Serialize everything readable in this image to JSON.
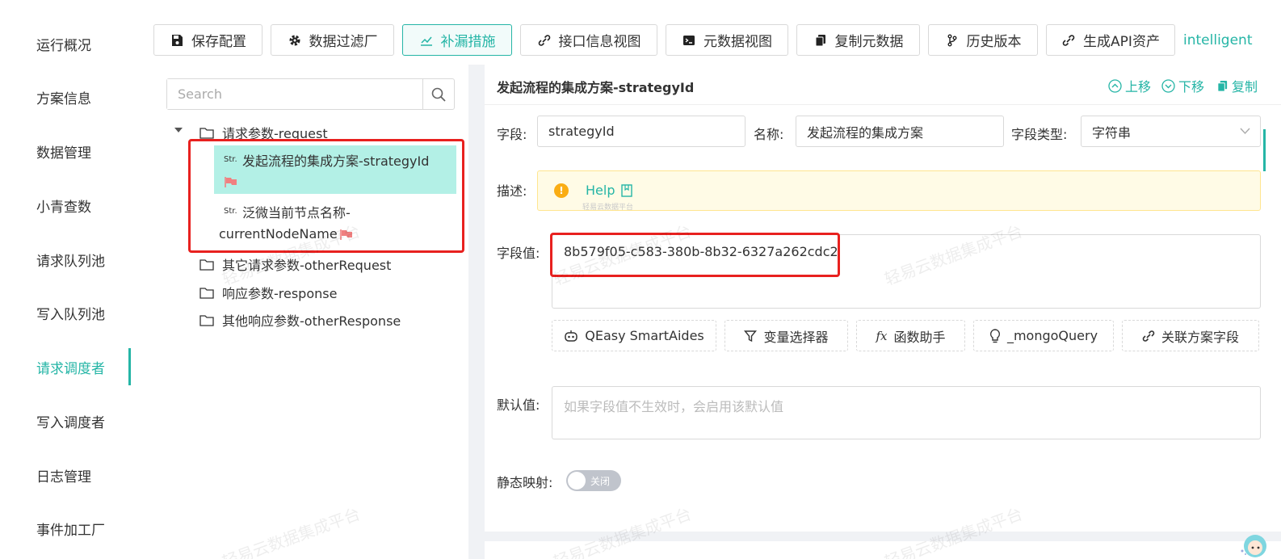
{
  "sidebar": {
    "items": [
      {
        "label": "运行概况"
      },
      {
        "label": "方案信息"
      },
      {
        "label": "数据管理"
      },
      {
        "label": "小青查数"
      },
      {
        "label": "请求队列池"
      },
      {
        "label": "写入队列池"
      },
      {
        "label": "请求调度者",
        "active": true
      },
      {
        "label": "写入调度者"
      },
      {
        "label": "日志管理"
      },
      {
        "label": "事件加工厂"
      }
    ]
  },
  "toolbar": {
    "buttons": [
      {
        "label": "保存配置",
        "icon": "save-icon"
      },
      {
        "label": "数据过滤厂",
        "icon": "gear-icon"
      },
      {
        "label": "补漏措施",
        "icon": "chart-line-icon",
        "active": true
      },
      {
        "label": "接口信息视图",
        "icon": "link-icon"
      },
      {
        "label": "元数据视图",
        "icon": "terminal-icon"
      },
      {
        "label": "复制元数据",
        "icon": "copy-icon"
      },
      {
        "label": "历史版本",
        "icon": "branch-icon"
      },
      {
        "label": "生成API资产",
        "icon": "link-icon"
      }
    ],
    "link_label": "intelligent"
  },
  "tree": {
    "search_placeholder": "Search",
    "nodes": {
      "request": "请求参数-request",
      "leaf1": "发起流程的集成方案-strategyId",
      "leaf2_line1": "泛微当前节点名称-",
      "leaf2_line2": "currentNodeName",
      "other_request": "其它请求参数-otherRequest",
      "response": "响应参数-response",
      "other_response": "其他响应参数-otherResponse"
    },
    "str_tag": "Str."
  },
  "detail": {
    "title": "发起流程的集成方案-strategyId",
    "actions": {
      "up": "上移",
      "down": "下移",
      "copy": "复制"
    },
    "field_label": "字段:",
    "field_value": "strategyId",
    "name_label": "名称:",
    "name_value": "发起流程的集成方案",
    "type_label": "字段类型:",
    "type_value": "字符串",
    "desc_label": "描述:",
    "help_label": "Help",
    "help_sub": "轻易云数据平台",
    "value_label": "字段值:",
    "value": "8b579f05-c583-380b-8b32-6327a262cdc2",
    "tools": [
      {
        "label": "QEasy SmartAides",
        "icon": "robot-icon"
      },
      {
        "label": "变量选择器",
        "icon": "filter-icon"
      },
      {
        "label": "函数助手",
        "icon": "fx-icon"
      },
      {
        "label": "_mongoQuery",
        "icon": "bulb-icon"
      },
      {
        "label": "关联方案字段",
        "icon": "link-icon"
      }
    ],
    "default_label": "默认值:",
    "default_placeholder": "如果字段值不生效时，会启用该默认值",
    "static_label": "静态映射:",
    "switch_off": "关闭"
  },
  "watermark": "轻易云数据集成平台",
  "colors": {
    "accent": "#25b5a6",
    "highlight": "#e8211f",
    "selected_bg": "#b3f0e6"
  }
}
